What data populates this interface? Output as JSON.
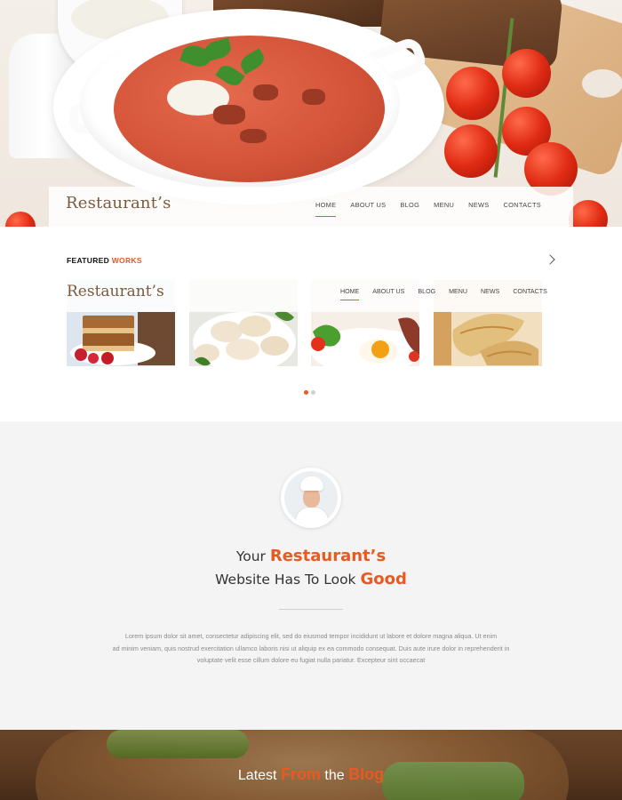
{
  "header": {
    "logo": "Restaurant’s",
    "nav": [
      {
        "label": "HOME",
        "active": true
      },
      {
        "label": "ABOUT US",
        "active": false
      },
      {
        "label": "BLOG",
        "active": false
      },
      {
        "label": "MENU",
        "active": false
      },
      {
        "label": "NEWS",
        "active": false
      },
      {
        "label": "CONTACTS",
        "active": false
      }
    ]
  },
  "featured": {
    "title_prefix": "FEATURED ",
    "title_accent": "WORKS",
    "next_icon": "chevron-right-icon",
    "slider_logo": "Restaurant’s",
    "slider_nav": [
      "HOME",
      "ABOUT US",
      "BLOG",
      "MENU",
      "NEWS",
      "CONTACTS"
    ],
    "thumbnails": [
      {
        "name": "cake-slices"
      },
      {
        "name": "dumplings"
      },
      {
        "name": "fried-egg-breakfast"
      },
      {
        "name": "crepes"
      }
    ],
    "dots": [
      true,
      false
    ]
  },
  "about": {
    "line1_prefix": "Your ",
    "line1_accent": "Restaurant’s",
    "line2_prefix": "Website Has To Look ",
    "line2_accent": "Good",
    "lorem_1": "Lorem ipsum dolor sit amet, consectetur adipiscing elit, sed do eiusmod tempor incididunt ut labore et dolore magna aliqua. Ut enim",
    "lorem_2": "ad minim veniam, quis nostrud exercitation ullamco laboris nisi ut aliquip ex ea commodo consequat. Duis aute irure dolor in reprehenderit in",
    "lorem_3": "voluptate velit esse cillum dolore eu fugiat nulla pariatur. Excepteur sint occaecat"
  },
  "blog": {
    "title_part1": "Latest ",
    "title_accent1": "From",
    "title_part2": " the ",
    "title_accent2": "Blog"
  },
  "colors": {
    "accent": "#e85a21",
    "logo": "#7a5a3c",
    "about_bg": "#f4f4f4"
  }
}
